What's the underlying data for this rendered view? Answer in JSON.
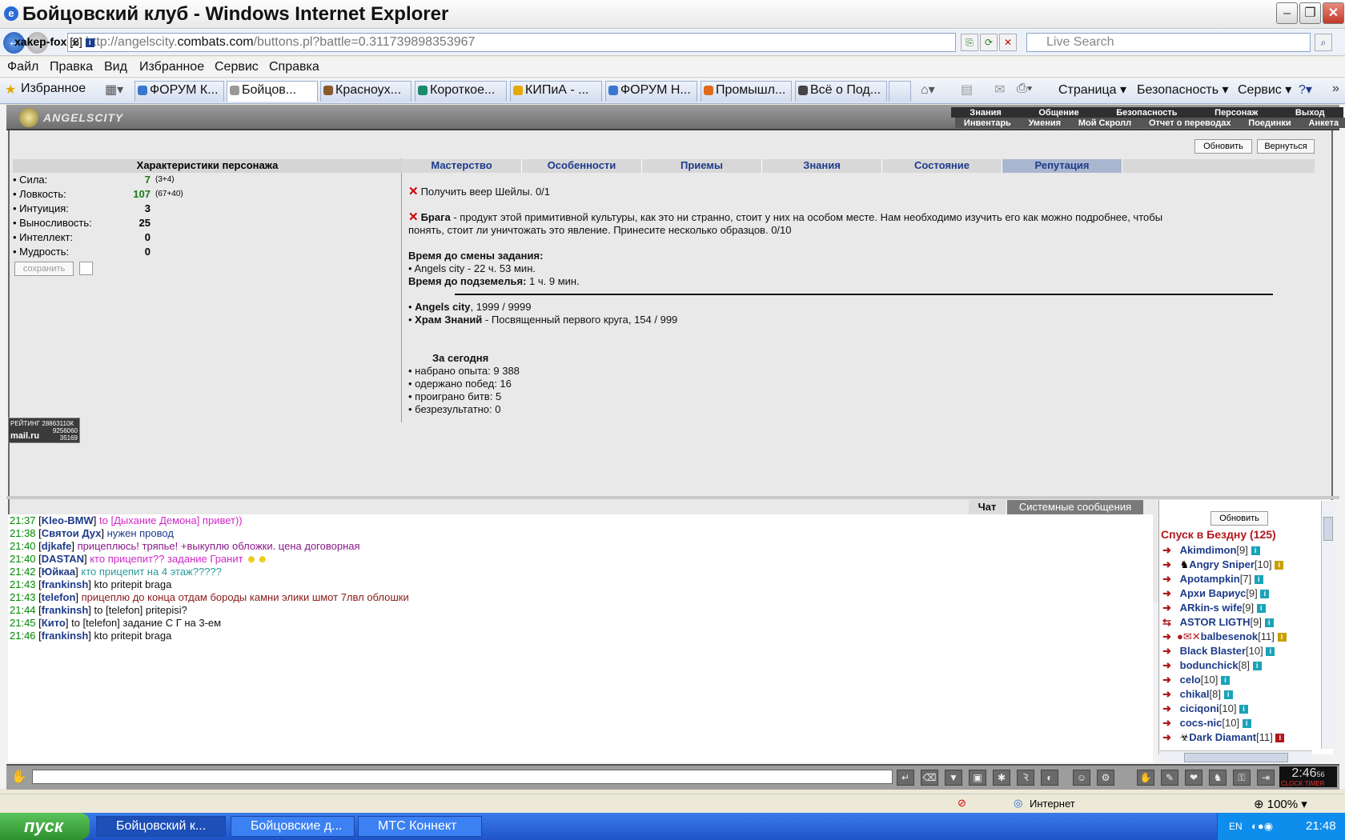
{
  "window": {
    "title": "Бойцовский клуб - Windows Internet Explorer"
  },
  "address": {
    "url_pre": "http://angelscity.",
    "url_host": "combats.com",
    "url_post": "/buttons.pl?battle=0.311739898353967",
    "search_placeholder": "Live Search"
  },
  "menu": [
    "Файл",
    "Правка",
    "Вид",
    "Избранное",
    "Сервис",
    "Справка"
  ],
  "favorites_label": "Избранное",
  "tabs": [
    "ФОРУМ К...",
    "Бойцов...",
    "Красноух...",
    "Короткое...",
    "КИПиА - ...",
    "ФОРУМ Н...",
    "Промышл...",
    "Всё о Под..."
  ],
  "ie_tools": [
    "Страница",
    "Безопасность",
    "Сервис"
  ],
  "game": {
    "logo": "ANGELSCITY",
    "nav1": [
      "Знания",
      "Общение",
      "Безопасность",
      "Персонаж",
      "Выход"
    ],
    "nav2": [
      "Инвентарь",
      "Умения",
      "Мой Скролл",
      "Отчет о переводах",
      "Поединки",
      "Анкета"
    ],
    "player": {
      "name": "xakep-fox",
      "level": "[8]"
    },
    "buttons": {
      "refresh": "Обновить",
      "back": "Вернуться",
      "save": "сохранить"
    },
    "stats_title": "Характеристики персонажа",
    "stats": [
      {
        "label": "• Сила:",
        "value": "7",
        "extra": "(3+4)",
        "green": true
      },
      {
        "label": "• Ловкость:",
        "value": "107",
        "extra": "(67+40)",
        "green": true
      },
      {
        "label": "• Интуиция:",
        "value": "3",
        "extra": "",
        "green": false
      },
      {
        "label": "• Выносливость:",
        "value": "25",
        "extra": "",
        "green": false
      },
      {
        "label": "• Интеллект:",
        "value": "0",
        "extra": "",
        "green": false
      },
      {
        "label": "• Мудрость:",
        "value": "0",
        "extra": "",
        "green": false
      }
    ],
    "ctabs": [
      "Мастерство",
      "Особенности",
      "Приемы",
      "Знания",
      "Состояние",
      "Репутация"
    ],
    "quest1": "Получить веер Шейлы. 0/1",
    "quest2_title": "Брага",
    "quest2_text": " - продукт этой примитивной культуры, как это ни странно, стоит у них на особом месте. Нам необходимо изучить его как можно подробнее, чтобы",
    "quest2_text2": "понять, стоит ли уничтожать это явление. Принесите несколько образцов. 0/10",
    "change_title": "Время до смены задания:",
    "change_line": "• Angels city - 22 ч. 53 мин.",
    "dungeon_title": "Время до подземелья:",
    "dungeon_val": " 1 ч. 9 мин.",
    "rep1_name": "Angels city",
    "rep1_val": ", 1999 / 9999",
    "rep2_name": "Храм Знаний",
    "rep2_val": " - Посвященный первого круга, 154 / 999",
    "today_title": "За сегодня",
    "today": [
      "• набрано опыта: 9 388",
      "• одержано побед: 16",
      "• проиграно битв: 5",
      "• безрезультатно: 0"
    ],
    "mail_badge": [
      "РЕЙТИНГ 28863110К",
      "9256060",
      "35169",
      "mail.ru"
    ]
  },
  "chat": {
    "tabs": [
      "Чат",
      "Системные сообщения"
    ],
    "lines": [
      {
        "time": "21:37",
        "nick": "Kleo-BMW",
        "msg": "to [Дыхание Демона] привет))",
        "color": "#d028c8"
      },
      {
        "time": "21:38",
        "nick": "Святои Дух",
        "msg": "нужен провод",
        "color": "#1d3b8a"
      },
      {
        "time": "21:40",
        "nick": "djkafe",
        "msg": "прицеплюсь! тряпье! +выкуплю обложки. цена договорная",
        "color": "#8a1a8a"
      },
      {
        "time": "21:40",
        "nick": "DASTAN",
        "msg": "кто прицепит?? задание Гранит",
        "color": "#d028c8"
      },
      {
        "time": "21:42",
        "nick": "Юйкаа",
        "msg": "кто прицепит на 4 этаж?????",
        "color": "#2a9a9a"
      },
      {
        "time": "21:43",
        "nick": "frankinsh",
        "msg": "kto pritepit braga",
        "color": "#111"
      },
      {
        "time": "21:43",
        "nick": "telefon",
        "msg": "прицеплю до конца отдам бороды камни элики шмот 7лвл облошки",
        "color": "#8a1a1a"
      },
      {
        "time": "21:44",
        "nick": "frankinsh",
        "msg": "to [telefon] pritepisi?",
        "color": "#111"
      },
      {
        "time": "21:45",
        "nick": "Кито",
        "msg": "to [telefon] задание С Г на 3-ем",
        "color": "#111"
      },
      {
        "time": "21:46",
        "nick": "frankinsh",
        "msg": "kto pritepit braga",
        "color": "#111"
      }
    ]
  },
  "userlist": {
    "refresh": "Обновить",
    "title": "Спуск в Бездну (125)",
    "users": [
      {
        "name": "Akimdimon",
        "level": "[9]"
      },
      {
        "name": "Angry Sniper",
        "level": "[10]"
      },
      {
        "name": "Apotampkin",
        "level": "[7]"
      },
      {
        "name": "Архи Вариус",
        "level": "[9]"
      },
      {
        "name": "ARkin-s wife",
        "level": "[9]"
      },
      {
        "name": "ASTOR LIGTH",
        "level": "[9]"
      },
      {
        "name": "balbesenok",
        "level": "[11]"
      },
      {
        "name": "Black Blaster",
        "level": "[10]"
      },
      {
        "name": "bodunchick",
        "level": "[8]"
      },
      {
        "name": "celo",
        "level": "[10]"
      },
      {
        "name": "chikal",
        "level": "[8]"
      },
      {
        "name": "ciciqoni",
        "level": "[10]"
      },
      {
        "name": "cocs-nic",
        "level": "[10]"
      },
      {
        "name": "Dark Diamant",
        "level": "[11]"
      }
    ]
  },
  "clock": {
    "time": "2:46",
    "sec": "56",
    "labels": "CLOCK TIMER"
  },
  "status": {
    "zone": "Интернет",
    "zoom": "100%"
  },
  "taskbar": {
    "start": "пуск",
    "tasks": [
      "Бойцовский к...",
      "Бойцовские д...",
      "МТС Коннект"
    ],
    "lang": "EN",
    "time": "21:48"
  }
}
